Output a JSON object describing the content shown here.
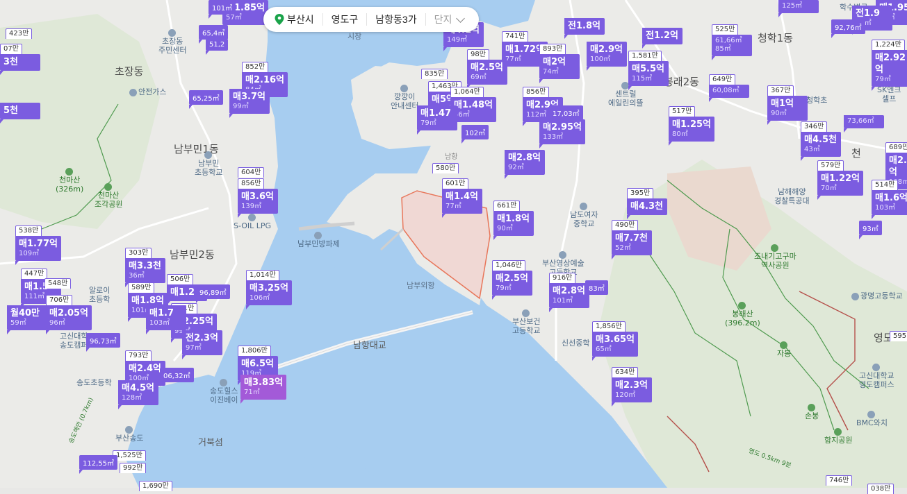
{
  "search": {
    "city": "부산시",
    "district": "영도구",
    "dong": "남항동3가",
    "complex": "단지",
    "pin_color": "#1aa34a"
  },
  "colors": {
    "water": "#a7cdf0",
    "land": "#e8e8e6",
    "park": "#d9e6cf",
    "marker": "#7b5ce0",
    "marker_selected": "#a35ad8",
    "area_outline": "#e8765a"
  },
  "places": [
    {
      "id": "chojang",
      "text": "초장동"
    },
    {
      "id": "nambumin1",
      "text": "남부민1동"
    },
    {
      "id": "nambumin2",
      "text": "남부민2동"
    },
    {
      "id": "bongnae2",
      "text": "봉래2동"
    },
    {
      "id": "cheongha1",
      "text": "청학1동"
    },
    {
      "id": "amnam",
      "text": "거북섬"
    },
    {
      "id": "namhangbridge",
      "text": "남항대교"
    },
    {
      "id": "seonjang",
      "text": "시장"
    },
    {
      "id": "nambu_port",
      "text": "남부외항"
    },
    {
      "id": "yeongdo",
      "text": "영도"
    },
    {
      "id": "cheon",
      "text": "천"
    }
  ],
  "pois": [
    {
      "id": "chojang_center",
      "text": "초장동\n주민센터"
    },
    {
      "id": "anjeon_gas",
      "text": "안전가스"
    },
    {
      "id": "cheonma",
      "text": "천마산\n(326m)"
    },
    {
      "id": "cheonma_park",
      "text": "천마산\n조각공원"
    },
    {
      "id": "nambumin_school",
      "text": "남부민\n초등학교"
    },
    {
      "id": "soil",
      "text": "S-OIL LPG"
    },
    {
      "id": "nambumin_pier",
      "text": "남부민방파제"
    },
    {
      "id": "kkangkkangi",
      "text": "깡깡이\n안내센터"
    },
    {
      "id": "central",
      "text": "센트럴\n에일린의뜰"
    },
    {
      "id": "namdo_girls",
      "text": "남도여자\n중학교"
    },
    {
      "id": "yeongsang",
      "text": "부산영상예술\n고등학교"
    },
    {
      "id": "bogeon",
      "text": "부산보건\n고등학교"
    },
    {
      "id": "shinseon",
      "text": "신선중학"
    },
    {
      "id": "namhae",
      "text": "남해해양\n경찰특공대"
    },
    {
      "id": "jonae",
      "text": "조내기고구마\n역사공원"
    },
    {
      "id": "bongnaesan",
      "text": "봉래산\n(396.2m)"
    },
    {
      "id": "gwangmyeong",
      "text": "광명고등학교"
    },
    {
      "id": "jabong",
      "text": "자봉"
    },
    {
      "id": "sonbong",
      "text": "손봉"
    },
    {
      "id": "goshin",
      "text": "고신대학교\n영도캠퍼스"
    },
    {
      "id": "bmc",
      "text": "BMC와치"
    },
    {
      "id": "hamji",
      "text": "함지공원"
    },
    {
      "id": "songdo_hills",
      "text": "송도힐스\n이진베이"
    },
    {
      "id": "songdo_school",
      "text": "송도초등학"
    },
    {
      "id": "busan_songdo",
      "text": "부산송도"
    },
    {
      "id": "goshin_songdo",
      "text": "고신대학\n송도캠퍼"
    },
    {
      "id": "hotel_area",
      "text": "알로이\n초등학"
    },
    {
      "id": "sk",
      "text": "SK엔크\n셀프"
    },
    {
      "id": "hwasu",
      "text": "학수변공"
    },
    {
      "id": "cheonghak_school",
      "text": "청학초"
    },
    {
      "id": "songdo_trail",
      "text": "송도해안 (0.7km)"
    },
    {
      "id": "yeongdo_trail",
      "text": "영도 0.5km 9분"
    },
    {
      "id": "unnamed_namhang",
      "text": "남항"
    }
  ],
  "listings": [
    {
      "id": "l1",
      "top": "",
      "price": "매1.85억",
      "area": "57㎡"
    },
    {
      "id": "l2",
      "top": "852만",
      "price": "매2.16억",
      "area": "84㎡"
    },
    {
      "id": "l3",
      "top": "",
      "price": "매3.7억",
      "area": "99㎡"
    },
    {
      "id": "l4",
      "top": "423만",
      "price": "",
      "area": ""
    },
    {
      "id": "l5",
      "top": "07만",
      "price": "3천",
      "area": ""
    },
    {
      "id": "l6",
      "top": "",
      "price": "5천",
      "area": ""
    },
    {
      "id": "l7",
      "top": "604만",
      "price": "",
      "area": ""
    },
    {
      "id": "l8",
      "top": "856만",
      "price": "매3.6억",
      "area": "139㎡"
    },
    {
      "id": "l9",
      "top": "538만",
      "price": "매1.77억",
      "area": "109㎡"
    },
    {
      "id": "l10",
      "top": "303만",
      "price": "매3.3천",
      "area": "36㎡"
    },
    {
      "id": "l11",
      "top": "447만",
      "price": "매1.5",
      "area": "111㎡"
    },
    {
      "id": "l12",
      "top": "548만",
      "price": "",
      "area": ""
    },
    {
      "id": "l13",
      "top": "706만",
      "price": "매2.05억",
      "area": "96㎡"
    },
    {
      "id": "l14",
      "top": "",
      "price": "월40만",
      "area": "59㎡"
    },
    {
      "id": "l15",
      "top": "589만",
      "price": "매1.8억",
      "area": "101㎡"
    },
    {
      "id": "l16",
      "top": "506만",
      "price": "매1.2",
      "area": ""
    },
    {
      "id": "l17",
      "top": "751만",
      "price": "매2.25억",
      "area": "99㎡"
    },
    {
      "id": "l18",
      "top": "",
      "price": "매1.7",
      "area": "103㎡"
    },
    {
      "id": "l19",
      "top": "1,014만",
      "price": "매3.25억",
      "area": "106㎡"
    },
    {
      "id": "l20",
      "top": "",
      "price": "전2.3억",
      "area": "97㎡"
    },
    {
      "id": "l21",
      "top": "1,806만",
      "price": "매6.5억",
      "area": "119㎡"
    },
    {
      "id": "l22",
      "top": "",
      "price": "매3.83억",
      "area": "71㎡",
      "selected": true
    },
    {
      "id": "l23",
      "top": "793만",
      "price": "매2.4억",
      "area": "100㎡"
    },
    {
      "id": "l24",
      "top": "",
      "price": "매4.5억",
      "area": "128㎡"
    },
    {
      "id": "l25",
      "top": "1,525만",
      "price": "",
      "area": ""
    },
    {
      "id": "l26",
      "top": "992만",
      "price": "",
      "area": ""
    },
    {
      "id": "l27",
      "top": "1,690만",
      "price": "",
      "area": ""
    },
    {
      "id": "l28",
      "top": "",
      "price": "매4.1억",
      "area": "149㎡"
    },
    {
      "id": "l29",
      "top": "741만",
      "price": "매1.72억",
      "area": "77㎡"
    },
    {
      "id": "l30",
      "top": "893만",
      "price": "매2억",
      "area": "74㎡"
    },
    {
      "id": "l31",
      "top": "",
      "price": "전1.8억",
      "area": ""
    },
    {
      "id": "l32",
      "top": "",
      "price": "매2.9억",
      "area": "100㎡"
    },
    {
      "id": "l33",
      "top": "1,581만",
      "price": "매5.5억",
      "area": "115㎡"
    },
    {
      "id": "l34",
      "top": "",
      "price": "전1.2억",
      "area": ""
    },
    {
      "id": "l35",
      "top": "835만",
      "price": "",
      "area": ""
    },
    {
      "id": "l36",
      "top": "98만",
      "price": "매2.5억",
      "area": "69㎡"
    },
    {
      "id": "l37",
      "top": "1,463만",
      "price": "매5억",
      "area": "113㎡"
    },
    {
      "id": "l38",
      "top": "1,064만",
      "price": "매1.48억",
      "area": "46㎡"
    },
    {
      "id": "l39",
      "top": "",
      "price": "매1.47",
      "area": "79㎡"
    },
    {
      "id": "l40",
      "top": "856만",
      "price": "매2.9억",
      "area": "112㎡"
    },
    {
      "id": "l41",
      "top": "",
      "price": "매2.95억",
      "area": "133㎡"
    },
    {
      "id": "l42",
      "top": "580만",
      "price": "",
      "area": ""
    },
    {
      "id": "l43",
      "top": "601만",
      "price": "매1.4억",
      "area": "77㎡"
    },
    {
      "id": "l44",
      "top": "",
      "price": "매2.8억",
      "area": "92㎡"
    },
    {
      "id": "l45",
      "top": "661만",
      "price": "매1.8억",
      "area": "90㎡"
    },
    {
      "id": "l46",
      "top": "1,046만",
      "price": "매2.5억",
      "area": "79㎡"
    },
    {
      "id": "l47",
      "top": "916만",
      "price": "매2.8억",
      "area": "101㎡"
    },
    {
      "id": "l48",
      "top": "395만",
      "price": "매4.3천",
      "area": ""
    },
    {
      "id": "l49",
      "top": "490만",
      "price": "매7.7천",
      "area": "52㎡"
    },
    {
      "id": "l50",
      "top": "1,856만",
      "price": "매3.65억",
      "area": "65㎡"
    },
    {
      "id": "l51",
      "top": "634만",
      "price": "매2.3억",
      "area": "120㎡"
    },
    {
      "id": "l52",
      "top": "525만",
      "price": "",
      "area": "61,66㎡"
    },
    {
      "id": "l53",
      "top": "",
      "price": "",
      "area": "85㎡"
    },
    {
      "id": "l54",
      "top": "517만",
      "price": "매1.25억",
      "area": "80㎡"
    },
    {
      "id": "l55",
      "top": "649만",
      "price": "",
      "area": "60,08㎡"
    },
    {
      "id": "l56",
      "top": "367만",
      "price": "매1억",
      "area": "90㎡"
    },
    {
      "id": "l57",
      "top": "346만",
      "price": "매4.5천",
      "area": "43㎡"
    },
    {
      "id": "l58",
      "top": "579만",
      "price": "매1.22억",
      "area": "70㎡"
    },
    {
      "id": "l59",
      "top": "689만",
      "price": "매2.25억",
      "area": "108㎡"
    },
    {
      "id": "l60",
      "top": "514만",
      "price": "매1.6억",
      "area": "103㎡"
    },
    {
      "id": "l61",
      "top": "1,224만",
      "price": "매2.92억",
      "area": "79㎡"
    },
    {
      "id": "l62",
      "top": "",
      "price": "매1.95",
      "area": "84㎡"
    },
    {
      "id": "l63",
      "top": "",
      "price": "전1.9",
      "area": "85㎡"
    },
    {
      "id": "l64",
      "top": "746만",
      "price": "",
      "area": ""
    },
    {
      "id": "l65",
      "top": "595",
      "price": "",
      "area": ""
    },
    {
      "id": "l66",
      "top": "",
      "price": "",
      "area": "125㎡"
    },
    {
      "id": "l67",
      "top": "",
      "price": "",
      "area": "73,66㎡"
    },
    {
      "id": "l68",
      "top": "038만",
      "price": "",
      "area": ""
    }
  ],
  "minis": [
    {
      "id": "m1",
      "text": "65,25㎡"
    },
    {
      "id": "m2",
      "text": "96,89㎡"
    },
    {
      "id": "m3",
      "text": "96,73㎡"
    },
    {
      "id": "m4",
      "text": "06,32㎡"
    },
    {
      "id": "m5",
      "text": "112,55㎡"
    },
    {
      "id": "m6",
      "text": "65,4㎡"
    },
    {
      "id": "m7",
      "text": "51,2"
    },
    {
      "id": "m8",
      "text": "101㎡"
    },
    {
      "id": "m9",
      "text": "92,76㎡"
    },
    {
      "id": "m10",
      "text": "83㎡"
    },
    {
      "id": "m11",
      "text": "17,03㎡"
    },
    {
      "id": "m12",
      "text": "102㎡"
    },
    {
      "id": "m13",
      "text": "93㎡"
    }
  ]
}
